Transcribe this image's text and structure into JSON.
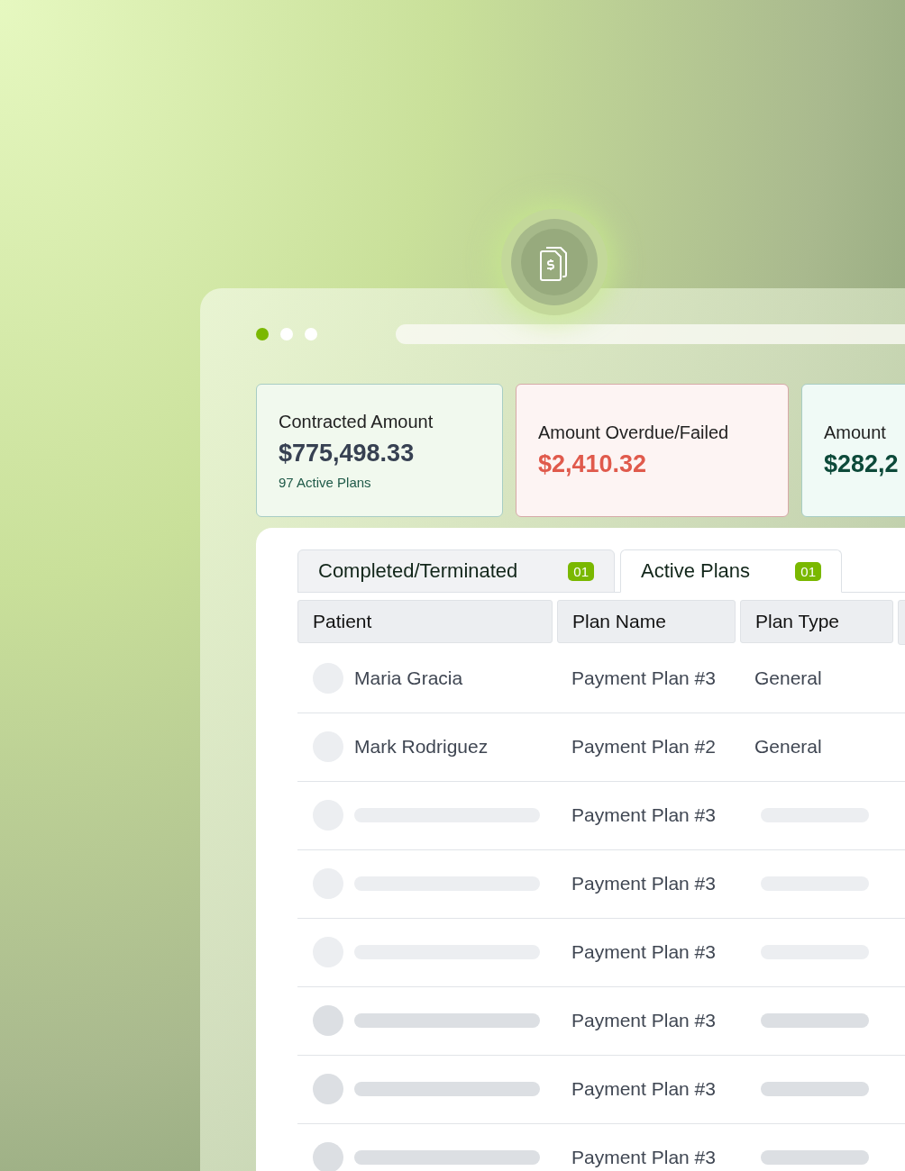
{
  "window_dots": [
    {
      "color": "#7ab800"
    },
    {
      "color": "#ffffff"
    },
    {
      "color": "#ffffff"
    }
  ],
  "summary_cards": [
    {
      "kind": "neutral",
      "title": "Contracted Amount",
      "amount": "$775,498.33",
      "note": "97 Active Plans"
    },
    {
      "kind": "alert",
      "title": "Amount Overdue/Failed",
      "amount": "$2,410.32"
    },
    {
      "kind": "positive",
      "title": "Amount",
      "amount": "$282,2"
    }
  ],
  "tabs": [
    {
      "label": "Completed/Terminated",
      "count": "01",
      "selected": false
    },
    {
      "label": "Active Plans",
      "count": "01",
      "selected": true
    }
  ],
  "table": {
    "columns": [
      "Patient",
      "Plan Name",
      "Plan Type"
    ],
    "rows": [
      {
        "kind": "filled",
        "patient": "Maria Gracia",
        "plan_name": "Payment Plan #3",
        "plan_type": "General"
      },
      {
        "kind": "filled",
        "patient": "Mark Rodriguez",
        "plan_name": "Payment Plan #2",
        "plan_type": "General"
      },
      {
        "kind": "skeleton",
        "plan_name": "Payment Plan #3"
      },
      {
        "kind": "skeleton",
        "plan_name": "Payment Plan #3"
      },
      {
        "kind": "skeleton",
        "plan_name": "Payment Plan #3"
      },
      {
        "kind": "skeleton",
        "plan_name": "Payment Plan #3"
      },
      {
        "kind": "skeleton",
        "plan_name": "Payment Plan #3"
      },
      {
        "kind": "skeleton",
        "plan_name": "Payment Plan #3"
      }
    ]
  }
}
